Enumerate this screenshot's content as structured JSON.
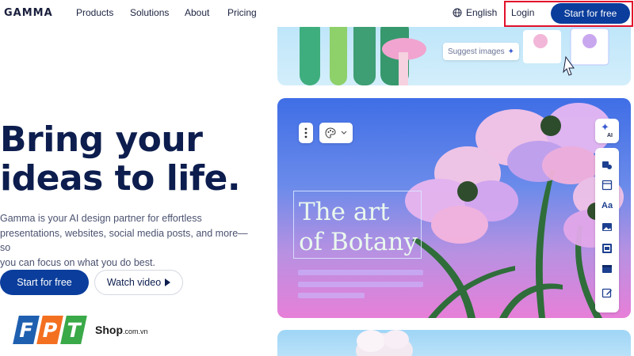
{
  "nav": {
    "logo": "GAMMA",
    "links": [
      "Products",
      "Solutions",
      "About",
      "Pricing"
    ],
    "language": "English",
    "login": "Login",
    "start_free": "Start for free"
  },
  "hero": {
    "title_line1": "Bring your",
    "title_line2": "ideas to life.",
    "subtitle_line1": "Gamma is your AI design partner for effortless",
    "subtitle_line2": "presentations, websites, social media posts, and more—so",
    "subtitle_line3": "you can focus on what you do best.",
    "start_button": "Start for free",
    "watch_button": "Watch video"
  },
  "preview_top": {
    "suggest_images": "Suggest images"
  },
  "preview_main": {
    "title_line1": "The art",
    "title_line2": "of Botany",
    "ai_badge": "AI",
    "text_tool_label": "Aa"
  },
  "watermark": {
    "letters": [
      "F",
      "P",
      "T"
    ],
    "shop": "Shop",
    "domain": ".com.vn"
  },
  "colors": {
    "brand_blue": "#0a3d9c",
    "heading": "#0c1d4e",
    "highlight": "#e2102a",
    "fpt_blue": "#1f5fb0",
    "fpt_orange": "#f37021",
    "fpt_green": "#3aa948"
  }
}
